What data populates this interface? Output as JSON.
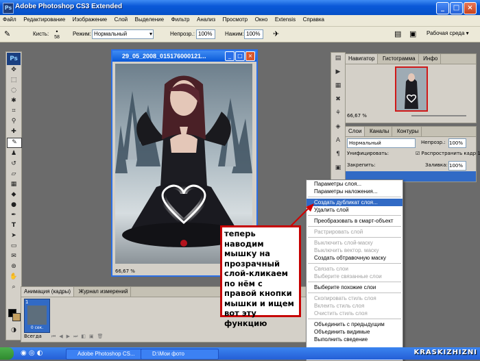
{
  "window": {
    "title": "Adobe Photoshop CS3 Extended",
    "app_icon_text": "Ps"
  },
  "menu": [
    "Файл",
    "Редактирование",
    "Изображение",
    "Слой",
    "Выделение",
    "Фильтр",
    "Анализ",
    "Просмотр",
    "Окно",
    "Extensis",
    "Справка"
  ],
  "options": {
    "brush_label": "Кисть:",
    "brush_size": "58",
    "mode_label": "Режим:",
    "mode_value": "Нормальный",
    "opacity_label": "Непрозр.:",
    "opacity_value": "100%",
    "pressure_label": "Нажим:",
    "pressure_value": "100%",
    "workspace": "Рабочая среда ▾"
  },
  "document": {
    "title": "29_05_2008_015176000121...",
    "zoom": "66,67 %"
  },
  "navigator": {
    "tabs": [
      "Навигатор",
      "Гистограмма",
      "Инфо"
    ],
    "zoom": "66,67 %"
  },
  "layers": {
    "tabs": [
      "Слои",
      "Каналы",
      "Контуры"
    ],
    "blend_mode": "Нормальный",
    "opacity_label": "Непрозр.:",
    "opacity_value": "100%",
    "unify_label": "Унифицировать:",
    "propagate_label": "Распространить кадр 1",
    "lock_label": "Закрепить:",
    "fill_label": "Заливка:",
    "fill_value": "100%"
  },
  "context_menu": [
    {
      "label": "Параметры слоя...",
      "state": "normal"
    },
    {
      "label": "Параметры наложения...",
      "state": "normal"
    },
    {
      "sep": true
    },
    {
      "label": "Создать дубликат слоя...",
      "state": "highlight"
    },
    {
      "label": "Удалить слой",
      "state": "normal"
    },
    {
      "sep": true
    },
    {
      "label": "Преобразовать в смарт-объект",
      "state": "normal"
    },
    {
      "sep": true
    },
    {
      "label": "Растрировать слой",
      "state": "disabled"
    },
    {
      "sep": true
    },
    {
      "label": "Выключить слой-маску",
      "state": "disabled"
    },
    {
      "label": "Выключить вектор. маску",
      "state": "disabled"
    },
    {
      "label": "Создать обтравочную маску",
      "state": "normal"
    },
    {
      "sep": true
    },
    {
      "label": "Связать слои",
      "state": "disabled"
    },
    {
      "label": "Выберите связанные слои",
      "state": "disabled"
    },
    {
      "sep": true
    },
    {
      "label": "Выберите похожие слои",
      "state": "normal"
    },
    {
      "sep": true
    },
    {
      "label": "Скопировать стиль слоя",
      "state": "disabled"
    },
    {
      "label": "Вклеить стиль слоя",
      "state": "disabled"
    },
    {
      "label": "Очистить стиль слоя",
      "state": "disabled"
    },
    {
      "sep": true
    },
    {
      "label": "Объединить с предыдущим",
      "state": "normal"
    },
    {
      "label": "Объединить видимые",
      "state": "normal"
    },
    {
      "label": "Выполнить сведение",
      "state": "normal"
    }
  ],
  "callout": "теперь наводим мышку на прозрачный слой-кликаем по нём с правой кнопки мышки и ищем вот эту функцию",
  "animation": {
    "tabs": [
      "Анимация (кадры)",
      "Журнал измерений"
    ],
    "frame_number": "1",
    "frame_delay": "0 сек.",
    "loop": "Всегда"
  },
  "taskbar": {
    "items": [
      "Adobe Photoshop CS...",
      "D:\\Мои фото"
    ],
    "watermark": "KRASKIZHIZNI"
  }
}
